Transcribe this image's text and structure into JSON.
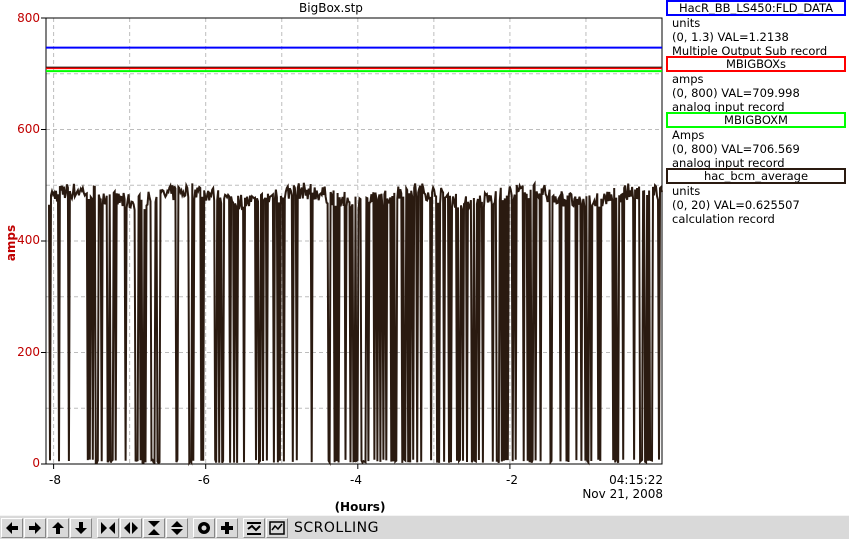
{
  "window": {
    "title": "BigBox.stp"
  },
  "axes": {
    "y_label": "amps",
    "y_ticks": [
      "800",
      "600",
      "400",
      "200",
      "0"
    ],
    "x_label": "(Hours)",
    "x_ticks": [
      "-8",
      "-6",
      "-4",
      "-2"
    ],
    "end_time": "04:15:22",
    "end_date": "Nov 21, 2008"
  },
  "legend": [
    {
      "name": "HacR_BB_LS450:FLD_DATA",
      "color": "#0000ff",
      "units": "units",
      "range_value": "(0, 1.3) VAL=1.2138",
      "record_type": "Multiple Output Sub record"
    },
    {
      "name": "MBIGBOXs",
      "color": "#ff0000",
      "units": "amps",
      "range_value": "(0, 800) VAL=709.998",
      "record_type": "analog input record"
    },
    {
      "name": "MBIGBOXM",
      "color": "#00ff00",
      "units": "Amps",
      "range_value": "(0, 800) VAL=706.569",
      "record_type": "analog input record"
    },
    {
      "name": "hac_bcm_average",
      "color": "#2a1a10",
      "units": "units",
      "range_value": "(0, 20) VAL=0.625507",
      "record_type": "calculation record"
    }
  ],
  "toolbar": {
    "buttons": [
      "arrow-left-icon",
      "arrow-right-icon",
      "arrow-up-icon",
      "arrow-down-icon",
      "zoom-in-x-icon",
      "zoom-out-x-icon",
      "zoom-in-y-icon",
      "zoom-out-y-icon",
      "auto-scale-icon",
      "add-trace-icon",
      "stagger-icon",
      "stagger-axis-icon"
    ],
    "status": "SCROLLING"
  },
  "chart_data": {
    "type": "line",
    "x_unit": "hours",
    "xlim": [
      -8.1,
      0
    ],
    "ylim": [
      0,
      800
    ],
    "grid": true,
    "series": [
      {
        "name": "HacR_BB_LS450:FLD_DATA",
        "color": "#0000ff",
        "value": 1.2138,
        "range": [
          0,
          1.3
        ]
      },
      {
        "name": "MBIGBOXs",
        "color": "#ff0000",
        "value": 709.998,
        "range": [
          0,
          800
        ]
      },
      {
        "name": "MBIGBOXM",
        "color": "#00ff00",
        "value": 706.569,
        "range": [
          0,
          800
        ]
      },
      {
        "name": "hac_bcm_average",
        "color": "#2a1a10",
        "range": [
          0,
          20
        ],
        "typical": 480
      }
    ]
  }
}
